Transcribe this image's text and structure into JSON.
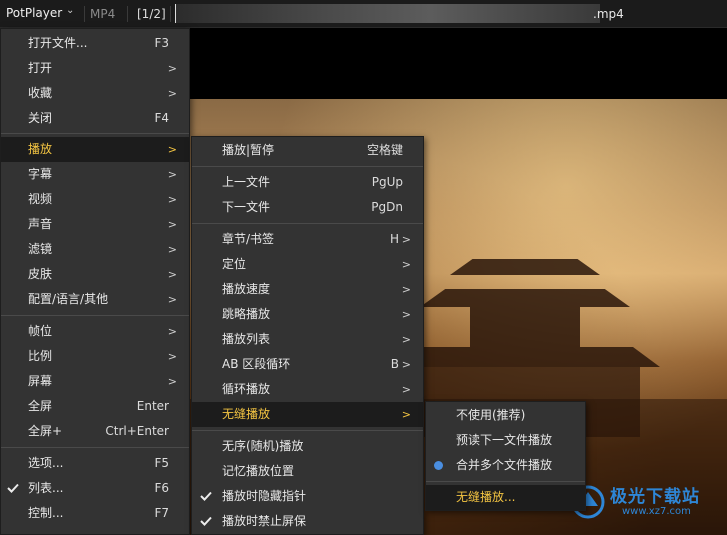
{
  "titlebar": {
    "app": "PotPlayer",
    "format": "MP4",
    "playlist_position": "[1/2]",
    "file_ext": ".mp4"
  },
  "main_menu": [
    {
      "label": "打开文件...",
      "shortcut": "F3"
    },
    {
      "label": "打开",
      "arrow": ">"
    },
    {
      "label": "收藏",
      "arrow": ">"
    },
    {
      "label": "关闭",
      "shortcut": "F4"
    },
    {
      "label": "播放",
      "arrow": ">"
    },
    {
      "label": "字幕",
      "arrow": ">"
    },
    {
      "label": "视频",
      "arrow": ">"
    },
    {
      "label": "声音",
      "arrow": ">"
    },
    {
      "label": "滤镜",
      "arrow": ">"
    },
    {
      "label": "皮肤",
      "arrow": ">"
    },
    {
      "label": "配置/语言/其他",
      "arrow": ">"
    },
    {
      "label": "帧位",
      "arrow": ">"
    },
    {
      "label": "比例",
      "arrow": ">"
    },
    {
      "label": "屏幕",
      "arrow": ">"
    },
    {
      "label": "全屏",
      "shortcut": "Enter"
    },
    {
      "label": "全屏+",
      "shortcut": "Ctrl+Enter"
    },
    {
      "label": "选项...",
      "shortcut": "F5"
    },
    {
      "label": "列表...",
      "shortcut": "F6",
      "checked": true
    },
    {
      "label": "控制...",
      "shortcut": "F7"
    }
  ],
  "play_menu": [
    {
      "label": "播放|暂停",
      "shortcut": "空格键"
    },
    {
      "label": "上一文件",
      "shortcut": "PgUp"
    },
    {
      "label": "下一文件",
      "shortcut": "PgDn"
    },
    {
      "label": "章节/书签",
      "shortcut": "H",
      "arrow": ">"
    },
    {
      "label": "定位",
      "arrow": ">"
    },
    {
      "label": "播放速度",
      "arrow": ">"
    },
    {
      "label": "跳略播放",
      "arrow": ">"
    },
    {
      "label": "播放列表",
      "arrow": ">"
    },
    {
      "label": "AB 区段循环",
      "shortcut": "B",
      "arrow": ">"
    },
    {
      "label": "循环播放",
      "arrow": ">"
    },
    {
      "label": "无缝播放",
      "arrow": ">"
    },
    {
      "label": "无序(随机)播放"
    },
    {
      "label": "记忆播放位置"
    },
    {
      "label": "播放时隐藏指针",
      "checked": true
    },
    {
      "label": "播放时禁止屏保",
      "checked": true
    }
  ],
  "seamless_menu": [
    {
      "label": "不使用(推荐)"
    },
    {
      "label": "预读下一文件播放"
    },
    {
      "label": "合并多个文件播放",
      "selected": true
    },
    {
      "label": "无缝播放..."
    }
  ],
  "watermark": {
    "text": "极光下载站",
    "url": "www.xz7.com"
  },
  "colors": {
    "menu_bg": "#333333",
    "highlight_bg": "#1c1c1c",
    "highlight_text": "#f4c542",
    "radio": "#4a8ee0"
  }
}
